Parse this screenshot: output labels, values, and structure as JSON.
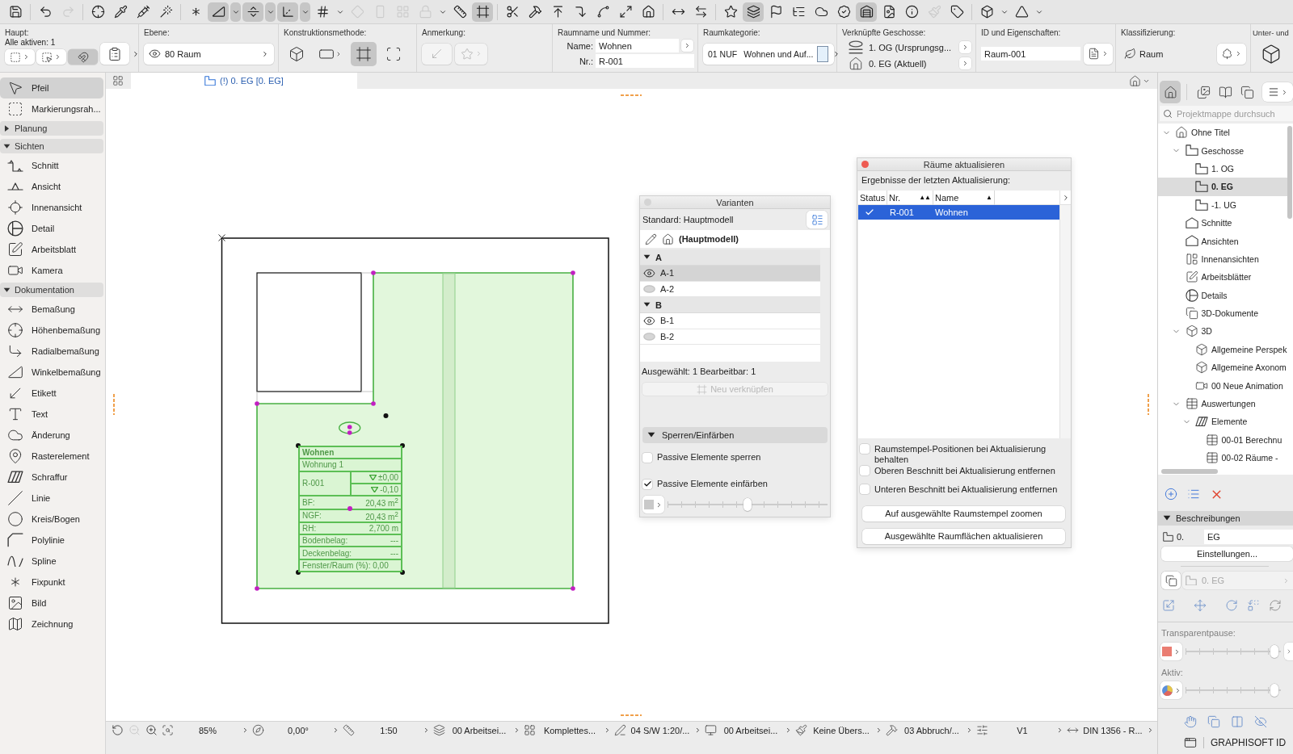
{
  "toolbar": {
    "groups": [
      [
        {
          "kind": "save",
          "pressed": false,
          "disabled": false
        }
      ],
      [
        {
          "kind": "undo",
          "pressed": false,
          "disabled": false
        },
        {
          "kind": "redo",
          "pressed": false,
          "disabled": true
        }
      ],
      [
        {
          "kind": "crosshair",
          "pressed": false,
          "disabled": false
        },
        {
          "kind": "pipette",
          "pressed": false,
          "disabled": false
        },
        {
          "kind": "syringe",
          "pressed": false,
          "disabled": false
        },
        {
          "kind": "wand",
          "pressed": false,
          "disabled": false
        }
      ],
      [
        {
          "kind": "asterisk",
          "pressed": false,
          "disabled": false
        },
        {
          "kind": "set-square",
          "pressed": true,
          "disabled": false
        },
        {
          "kind": "caret",
          "pressed": true,
          "disabled": false
        },
        {
          "kind": "guide",
          "pressed": true,
          "disabled": false
        },
        {
          "kind": "caret",
          "pressed": true,
          "disabled": false
        },
        {
          "kind": "axes",
          "pressed": true,
          "disabled": false
        },
        {
          "kind": "caret",
          "pressed": true,
          "disabled": false
        },
        {
          "kind": "grid",
          "pressed": false,
          "disabled": false
        },
        {
          "kind": "caret",
          "pressed": false,
          "disabled": false
        },
        {
          "kind": "plane",
          "pressed": false,
          "disabled": true
        },
        {
          "kind": "panel",
          "pressed": false,
          "disabled": true
        },
        {
          "kind": "tiles",
          "pressed": false,
          "disabled": true
        },
        {
          "kind": "lock",
          "pressed": false,
          "disabled": true
        },
        {
          "kind": "caret",
          "pressed": false,
          "disabled": false
        },
        {
          "kind": "ruler",
          "pressed": false,
          "disabled": false
        },
        {
          "kind": "frame",
          "pressed": true,
          "disabled": false
        }
      ],
      [
        {
          "kind": "scissors",
          "pressed": false,
          "disabled": false
        },
        {
          "kind": "hammer",
          "pressed": false,
          "disabled": false
        },
        {
          "kind": "align",
          "pressed": false,
          "disabled": false
        },
        {
          "kind": "corner",
          "pressed": false,
          "disabled": false
        },
        {
          "kind": "curve",
          "pressed": false,
          "disabled": false
        },
        {
          "kind": "resize",
          "pressed": false,
          "disabled": false
        },
        {
          "kind": "house",
          "pressed": false,
          "disabled": false
        }
      ],
      [
        {
          "kind": "dimension",
          "pressed": false,
          "disabled": false
        },
        {
          "kind": "distribute",
          "pressed": false,
          "disabled": false
        }
      ],
      [
        {
          "kind": "star",
          "pressed": false,
          "disabled": false
        },
        {
          "kind": "layers",
          "pressed": true,
          "disabled": false
        },
        {
          "kind": "flag",
          "pressed": false,
          "disabled": false
        },
        {
          "kind": "tree",
          "pressed": false,
          "disabled": false
        },
        {
          "kind": "cloud",
          "pressed": false,
          "disabled": false
        },
        {
          "kind": "badge",
          "pressed": false,
          "disabled": false
        },
        {
          "kind": "warehouse",
          "pressed": true,
          "disabled": false
        },
        {
          "kind": "file",
          "pressed": false,
          "disabled": false
        },
        {
          "kind": "info",
          "pressed": false,
          "disabled": false
        },
        {
          "kind": "brush",
          "pressed": false,
          "disabled": true
        },
        {
          "kind": "tag",
          "pressed": false,
          "disabled": false
        }
      ],
      [
        {
          "kind": "cube",
          "pressed": false,
          "disabled": false
        },
        {
          "kind": "caret",
          "pressed": false,
          "disabled": false
        },
        {
          "kind": "triangle",
          "pressed": false,
          "disabled": false
        },
        {
          "kind": "caret",
          "pressed": false,
          "disabled": false
        }
      ]
    ]
  },
  "info_box": {
    "main": {
      "title": "Haupt:",
      "subtitle": "Alle aktiven: 1",
      "buttons": [
        {
          "kind": "marquee",
          "dropdown": true,
          "pressed": false
        },
        {
          "kind": "marquee-arrow",
          "dropdown": true,
          "pressed": false
        },
        {
          "kind": "magnet",
          "dropdown": false,
          "pressed": true
        }
      ]
    },
    "layer": {
      "title": "Ebene:",
      "value": "80 Raum"
    },
    "construction": {
      "title": "Konstruktionsmethode:",
      "methods": [
        {
          "kind": "cube",
          "dropdown": false,
          "selected": false
        },
        {
          "kind": "slab",
          "dropdown": true,
          "selected": false
        },
        {
          "kind": "frame",
          "dropdown": false,
          "selected": true
        },
        {
          "kind": "scan",
          "dropdown": false,
          "selected": false
        }
      ]
    },
    "annotation": {
      "title": "Anmerkung:",
      "disabled": true
    },
    "room": {
      "title": "Raumname und Nummer:",
      "name_label": "Name:",
      "name": "Wohnen",
      "number_label": "Nr.:",
      "number": "R-001"
    },
    "category": {
      "title": "Raumkategorie:",
      "code": "01 NUF",
      "value": "Wohnen und Auf..."
    },
    "linked_stories": {
      "title": "Verknüpfte Geschosse:",
      "rows": [
        {
          "kind": "link-story",
          "label": "1. OG (Ursprungsg..."
        },
        {
          "kind": "home-story",
          "label": "0. EG (Aktuell)"
        }
      ]
    },
    "id": {
      "title": "ID und Eigenschaften:",
      "value": "Raum-001"
    },
    "classification": {
      "title": "Klassifizierung:",
      "value": "Raum"
    },
    "sub_elements": {
      "title": "Unter- und"
    }
  },
  "view_tabs": [
    {
      "label": "(!) 0. EG [0. EG]",
      "selected": true
    }
  ],
  "toolbox": {
    "tools": [
      {
        "kind": "pointer",
        "label": "Pfeil",
        "selected": true
      },
      {
        "kind": "marquee",
        "label": "Markierungsrah...",
        "selected": false
      }
    ],
    "groups": [
      {
        "label": "Planung",
        "expanded": false
      },
      {
        "label": "Sichten",
        "expanded": true,
        "children": [
          {
            "kind": "section",
            "label": "Schnitt",
            "selected": false
          },
          {
            "kind": "elevation",
            "label": "Ansicht",
            "selected": false
          },
          {
            "kind": "interior",
            "label": "Innenansicht",
            "selected": false
          },
          {
            "kind": "detail",
            "label": "Detail",
            "selected": false
          },
          {
            "kind": "worksheet",
            "label": "Arbeitsblatt",
            "selected": false
          },
          {
            "kind": "camera",
            "label": "Kamera",
            "selected": false
          }
        ]
      },
      {
        "label": "Dokumentation",
        "expanded": true,
        "children": [
          {
            "kind": "dimension",
            "label": "Bemaßung",
            "selected": false
          },
          {
            "kind": "level-dim",
            "label": "Höhenbemaßung",
            "selected": false
          },
          {
            "kind": "radial",
            "label": "Radialbemaßung",
            "selected": false
          },
          {
            "kind": "angle",
            "label": "Winkelbemaßung",
            "selected": false
          },
          {
            "kind": "label",
            "label": "Etikett",
            "selected": false
          },
          {
            "kind": "text",
            "label": "Text",
            "selected": false
          },
          {
            "kind": "revision",
            "label": "Änderung",
            "selected": false
          },
          {
            "kind": "grid-element",
            "label": "Rasterelement",
            "selected": false
          },
          {
            "kind": "hatch",
            "label": "Schraffur",
            "selected": false
          },
          {
            "kind": "line",
            "label": "Linie",
            "selected": false
          },
          {
            "kind": "arc",
            "label": "Kreis/Bogen",
            "selected": false
          },
          {
            "kind": "polyline",
            "label": "Polylinie",
            "selected": false
          },
          {
            "kind": "spline",
            "label": "Spline",
            "selected": false
          },
          {
            "kind": "hotspot",
            "label": "Fixpunkt",
            "selected": false
          },
          {
            "kind": "image",
            "label": "Bild",
            "selected": false
          },
          {
            "kind": "drawing",
            "label": "Zeichnung",
            "selected": false
          }
        ]
      }
    ]
  },
  "canvas": {
    "room_stamp": {
      "name": "Wohnen",
      "unit": "Wohnung 1",
      "number": "R-001",
      "levels": [
        "±0,00",
        "-0,10"
      ],
      "rows": [
        {
          "label": "BF:",
          "value": "20,43 m$^{2}$"
        },
        {
          "label": "NGF:",
          "value": "20,43 m$^{2}$"
        },
        {
          "label": "RH:",
          "value": "2,700 m"
        },
        {
          "label": "Bodenbelag:",
          "value": "---"
        },
        {
          "label": "Deckenbelag:",
          "value": "---"
        }
      ],
      "footer": "Fenster/Raum (%): 0,00"
    }
  },
  "variants_panel": {
    "title": "Varianten",
    "standard": "Standard: Hauptmodell",
    "model": "(Hauptmodell)",
    "groups": [
      {
        "label": "A",
        "expanded": true,
        "children": [
          {
            "label": "A-1",
            "visible": true,
            "selected": true
          },
          {
            "label": "A-2",
            "visible": false,
            "selected": false
          }
        ]
      },
      {
        "label": "B",
        "expanded": true,
        "children": [
          {
            "label": "B-1",
            "visible": true,
            "selected": false
          },
          {
            "label": "B-2",
            "visible": false,
            "selected": false
          }
        ]
      }
    ],
    "summary": "Ausgewählt: 1 Bearbeitbar: 1",
    "relink_button": {
      "label": "Neu verknüpfen",
      "disabled": true
    },
    "section": {
      "label": "Sperren/Einfärben",
      "expanded": true
    },
    "options": [
      {
        "label": "Passive Elemente sperren",
        "checked": false
      },
      {
        "label": "Passive Elemente einfärben",
        "checked": true
      }
    ],
    "tint": {
      "level": 0.5
    }
  },
  "update_panel": {
    "title": "Räume aktualisieren",
    "subtitle": "Ergebnisse der letzten Aktualisierung:",
    "columns": [
      {
        "label": "Status"
      },
      {
        "label": "Nr.",
        "sort_mark": "▲▲"
      },
      {
        "label": "Name",
        "sort_mark": "▲"
      }
    ],
    "rows": [
      {
        "updated": true,
        "number": "R-001",
        "name": "Wohnen",
        "selected": true
      }
    ],
    "options": [
      {
        "label": "Raumstempel-Positionen bei Aktualisierung behalten",
        "checked": false
      },
      {
        "label": "Oberen Beschnitt bei Aktualisierung entfernen",
        "checked": false
      },
      {
        "label": "Unteren Beschnitt bei Aktualisierung entfernen",
        "checked": false
      }
    ],
    "buttons": [
      "Auf ausgewählte Raumstempel zoomen",
      "Ausgewählte Raumflächen aktualisieren"
    ]
  },
  "navigator": {
    "views": [
      {
        "kind": "house",
        "selected": true
      },
      {
        "kind": "images",
        "selected": false
      },
      {
        "kind": "book",
        "selected": false
      },
      {
        "kind": "pages",
        "selected": false
      }
    ],
    "search": {
      "placeholder": "Projektmappe durchsuch"
    },
    "tree": [
      {
        "kind": "house",
        "label": "Ohne Titel",
        "expanded": true,
        "selected": false,
        "children": [
          {
            "kind": "story",
            "label": "Geschosse",
            "expanded": true,
            "selected": false,
            "children": [
              {
                "kind": "story",
                "label": "1. OG",
                "selected": false
              },
              {
                "kind": "story",
                "label": "0. EG",
                "selected": true
              },
              {
                "kind": "story",
                "label": "-1. UG",
                "selected": false
              }
            ]
          },
          {
            "kind": "roof",
            "label": "Schnitte",
            "selected": false
          },
          {
            "kind": "roof",
            "label": "Ansichten",
            "selected": false
          },
          {
            "kind": "interiors",
            "label": "Innenansichten",
            "selected": false
          },
          {
            "kind": "worksheet",
            "label": "Arbeitsblätter",
            "selected": false
          },
          {
            "kind": "detail",
            "label": "Details",
            "selected": false
          },
          {
            "kind": "pages",
            "label": "3D-Dokumente",
            "selected": false
          },
          {
            "kind": "cube",
            "label": "3D",
            "expanded": true,
            "selected": false,
            "children": [
              {
                "kind": "cube",
                "label": "Allgemeine Perspek",
                "selected": false
              },
              {
                "kind": "cube",
                "label": "Allgemeine Axonom",
                "selected": false
              },
              {
                "kind": "camera",
                "label": "00 Neue Animation",
                "selected": false
              }
            ]
          },
          {
            "kind": "table",
            "label": "Auswertungen",
            "expanded": true,
            "selected": false,
            "children": [
              {
                "kind": "hatch",
                "label": "Elemente",
                "expanded": true,
                "selected": false,
                "children": [
                  {
                    "kind": "table",
                    "label": "00-01 Berechnu",
                    "selected": false
                  },
                  {
                    "kind": "table",
                    "label": "00-02 Räume -",
                    "selected": false
                  }
                ]
              }
            ]
          }
        ]
      }
    ],
    "description": {
      "title": "Beschreibungen",
      "expanded": true,
      "prefix": "0.",
      "value": "EG"
    },
    "settings_button": "Einstellungen...",
    "story_select": {
      "value": "0. EG",
      "disabled": true
    },
    "transparency": {
      "title": "Transparentpause:",
      "level": 0.97
    },
    "active": {
      "title": "Aktiv:",
      "level": 0.97
    },
    "brand": "GRAPHISOFT ID"
  },
  "status_bar": {
    "nav": [
      {
        "kind": "rotate-ccw",
        "disabled": false
      },
      {
        "kind": "zoom-out",
        "disabled": true
      },
      {
        "kind": "zoom-in",
        "disabled": false
      }
    ],
    "fields": [
      {
        "kind": "zoom",
        "value": "85%"
      },
      {
        "kind": "compass",
        "value": "0,00°"
      },
      {
        "kind": "ruler",
        "value": "1:50"
      },
      {
        "kind": "layers",
        "value": "00 Arbeitsei..."
      },
      {
        "kind": "tiles",
        "value": "Komplettes..."
      },
      {
        "kind": "pen-line",
        "value": "04 S/W 1:20/..."
      },
      {
        "kind": "monitor",
        "value": "00 Arbeitsei..."
      },
      {
        "kind": "brush",
        "value": "Keine Übers..."
      },
      {
        "kind": "hammer",
        "value": "03 Abbruch/..."
      },
      {
        "kind": "sliders",
        "value": "V1"
      },
      {
        "kind": "dimension",
        "value": "DIN 1356 - R..."
      }
    ]
  }
}
